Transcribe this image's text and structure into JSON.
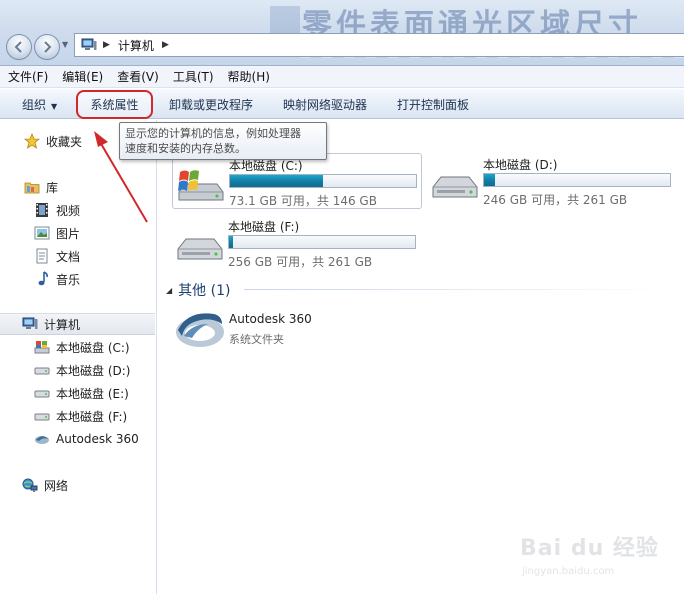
{
  "address_bar": {
    "path": [
      "计算机"
    ]
  },
  "menu": {
    "items": [
      "文件(F)",
      "编辑(E)",
      "查看(V)",
      "工具(T)",
      "帮助(H)"
    ]
  },
  "toolbar": {
    "organize_label": "组织",
    "system_properties_label": "系统属性",
    "uninstall_label": "卸载或更改程序",
    "map_drive_label": "映射网络驱动器",
    "control_panel_label": "打开控制面板"
  },
  "tooltip": {
    "line1": "显示您的计算机的信息，例如处理器",
    "line2": "速度和安装的内存总数。"
  },
  "sidebar": {
    "favorites": "收藏夹",
    "libraries": "库",
    "library_items": [
      "视频",
      "图片",
      "文档",
      "音乐"
    ],
    "computer": "计算机",
    "computer_items": [
      "本地磁盘 (C:)",
      "本地磁盘 (D:)",
      "本地磁盘 (E:)",
      "本地磁盘 (F:)",
      "Autodesk 360"
    ],
    "network": "网络"
  },
  "drives": [
    {
      "name": "本地磁盘 (C:)",
      "free_text": "73.1 GB 可用，共 146 GB",
      "used_fraction": 0.5
    },
    {
      "name": "本地磁盘 (D:)",
      "free_text": "246 GB 可用，共 261 GB",
      "used_fraction": 0.057
    },
    {
      "name": "本地磁盘 (F:)",
      "free_text": "256 GB 可用，共 261 GB",
      "used_fraction": 0.019
    }
  ],
  "other_group": {
    "header": "其他 (1)",
    "item_name": "Autodesk 360",
    "item_type": "系统文件夹"
  },
  "colors": {
    "highlight_outline": "#d1282c",
    "drive_bar_fill": "#137fa6",
    "group_header": "#1e3f73"
  },
  "watermark": {
    "logo": "Bai du 经验",
    "url": "jingyan.baidu.com"
  }
}
